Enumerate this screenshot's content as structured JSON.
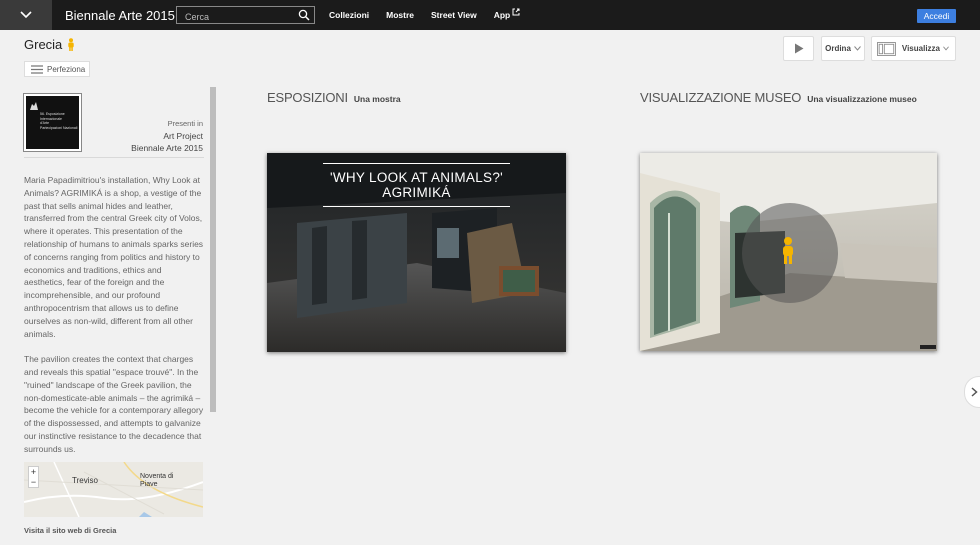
{
  "topbar": {
    "app_title": "Biennale Arte 2015",
    "search_placeholder": "Cerca",
    "nav": [
      "Collezioni",
      "Mostre",
      "Street View",
      "App"
    ],
    "signin_label": "Accedi"
  },
  "header": {
    "title": "Grecia",
    "refine_label": "Perfeziona",
    "sort_label": "Ordina",
    "view_label": "Visualizza"
  },
  "sidebar": {
    "presenter_label": "Presenti in",
    "presenter_lines": [
      "Art Project",
      "Biennale Arte 2015"
    ],
    "logo_lines": [
      "56. Esposizione",
      "Internazionale",
      "d'Arte",
      "Partecipazioni Nazionali"
    ],
    "description": [
      "Maria Papadimitriou's installation, Why Look at Animals? AGRIMIKÁ is a shop, a vestige of the past that sells animal hides and leather, transferred from the central Greek city of Volos, where it operates. This presentation of the relationship of humans to animals sparks series of concerns ranging from politics and history to economics and traditions, ethics and aesthetics, fear of the foreign and the incomprehensible, and our profound anthropocentrism that allows us to define ourselves as non-wild, different from all other animals.",
      "The pavilion creates the context that charges and reveals this spatial \"espace trouvé\". In the \"ruined\" landscape of the Greek pavilion, the non-domesticate-able animals – the agrimiká – become the vehicle for a contemporary allegory of the dispossessed, and attempts to galvanize our instinctive resistance to the decadence that surrounds us."
    ],
    "map": {
      "city1": "Treviso",
      "city2": "Noventa di Piave",
      "zoom_in": "+",
      "zoom_out": "−"
    },
    "visit_link": "Visita il sito web di Grecia"
  },
  "sections": [
    {
      "title": "ESPOSIZIONI",
      "subtitle": "Una mostra",
      "card_caption": "'WHY LOOK AT ANIMALS?' AGRIMIKÁ"
    },
    {
      "title": "VISUALIZZAZIONE MUSEO",
      "subtitle": "Una visualizzazione museo"
    }
  ],
  "icons": {
    "menu": "chevron-down-icon",
    "search": "search-icon",
    "external": "external-link-icon",
    "pegman": "pegman-icon",
    "play": "play-icon",
    "view": "layout-icon",
    "next": "chevron-right-icon"
  },
  "colors": {
    "accent": "#3d7fe0",
    "topbar": "#1b1b1b",
    "pegman": "#f5b400"
  }
}
